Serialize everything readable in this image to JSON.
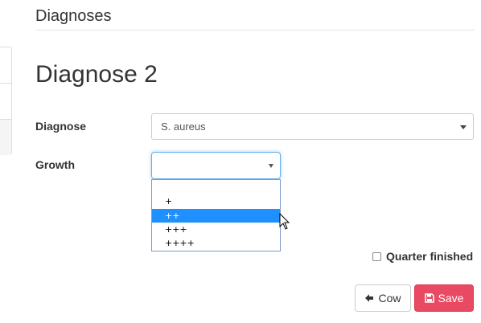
{
  "header": {
    "section_title": "Diagnoses"
  },
  "main": {
    "heading": "Diagnose 2",
    "diagnose": {
      "label": "Diagnose",
      "selected": "S. aureus"
    },
    "growth": {
      "label": "Growth",
      "selected": "",
      "options": [
        "",
        "+",
        "++",
        "+++",
        "++++"
      ],
      "highlighted_option": "++"
    },
    "quarter_finished": {
      "label": "Quarter finished",
      "checked": false
    },
    "buttons": {
      "back_label": "Cow",
      "save_label": "Save"
    }
  },
  "colors": {
    "save_button": "#e84a63",
    "highlight": "#1e90ff",
    "focus_border": "#66afe9"
  },
  "icons": [
    "arrow-left-icon",
    "floppy-disk-icon",
    "mouse-cursor-icon",
    "chevron-down-icon"
  ]
}
